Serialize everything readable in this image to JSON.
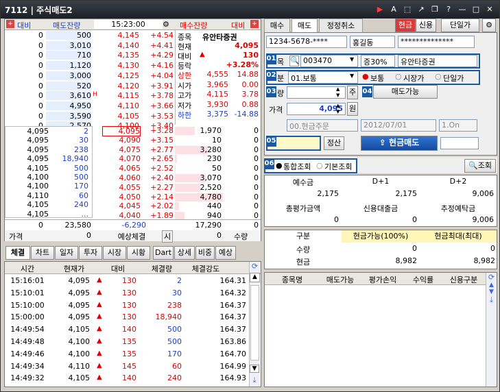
{
  "window": {
    "title": "7112 | 주식매도2"
  },
  "left": {
    "hdr": {
      "daebi": "대비",
      "sell_remain": "매도잔량",
      "time": "15:23:00",
      "buy_remain": "매수잔량",
      "daebi2": "대비"
    },
    "ask": [
      {
        "d": "0",
        "q": "500",
        "p": "4,145",
        "c": "+4.54"
      },
      {
        "d": "0",
        "q": "3,010",
        "p": "4,140",
        "c": "+4.41"
      },
      {
        "d": "0",
        "q": "710",
        "p": "4,135",
        "c": "+4.29"
      },
      {
        "d": "0",
        "q": "1,120",
        "p": "4,130",
        "c": "+4.16"
      },
      {
        "d": "0",
        "q": "3,000",
        "p": "4,125",
        "c": "+4.04"
      },
      {
        "d": "0",
        "q": "520",
        "p": "4,120",
        "c": "+3.91"
      },
      {
        "d": "0",
        "q": "3,610",
        "p": "4,115",
        "c": "+3.78",
        "mark": "H"
      },
      {
        "d": "0",
        "q": "4,950",
        "p": "4,110",
        "c": "+3.66"
      },
      {
        "d": "0",
        "q": "3,590",
        "p": "4,105",
        "c": "+3.53"
      },
      {
        "d": "0",
        "q": "2,570",
        "p": "4,100",
        "c": "+3.40"
      }
    ],
    "bid": [
      {
        "p": "4,095",
        "c": "+3.28",
        "q": "1,970",
        "d": "0"
      },
      {
        "p": "4,090",
        "c": "+3.15",
        "q": "10",
        "d": "0"
      },
      {
        "p": "4,075",
        "c": "+2.77",
        "q": "3,280",
        "d": "0"
      },
      {
        "p": "4,070",
        "c": "+2.65",
        "q": "230",
        "d": "0"
      },
      {
        "p": "4,065",
        "c": "+2.52",
        "q": "50",
        "d": "0"
      },
      {
        "p": "4,060",
        "c": "+2.40",
        "q": "3,070",
        "d": "0"
      },
      {
        "p": "4,055",
        "c": "+2.27",
        "q": "2,520",
        "d": "0"
      },
      {
        "p": "4,050",
        "c": "+2.14",
        "q": "4,780",
        "d": "0"
      },
      {
        "p": "4,045",
        "c": "+2.02",
        "q": "440",
        "d": "0"
      },
      {
        "p": "4,040",
        "c": "+1.89",
        "q": "940",
        "d": "0"
      }
    ],
    "trades": [
      {
        "p": "4,095",
        "q": "2"
      },
      {
        "p": "4,095",
        "q": "30"
      },
      {
        "p": "4,095",
        "q": "238"
      },
      {
        "p": "4,095",
        "q": "18,940"
      },
      {
        "p": "4,105",
        "q": "500"
      },
      {
        "p": "4,100",
        "q": "500"
      },
      {
        "p": "4,100",
        "q": "170"
      },
      {
        "p": "4,110",
        "q": "60"
      },
      {
        "p": "4,105",
        "q": "240"
      },
      {
        "p": "4,105",
        "q": "..."
      }
    ],
    "info": {
      "stock_lbl": "종목",
      "stock": "유안타증권",
      "cur_lbl": "현재",
      "cur": "4,095",
      "diff_lbl": "대비",
      "diff": "130",
      "rate_lbl": "등락",
      "rate": "+3.28%",
      "rows": [
        {
          "l": "상한",
          "v": "4,555",
          "r": "14.88",
          "cls": "red"
        },
        {
          "l": "시가",
          "v": "3,965",
          "r": "0.00",
          "cls": ""
        },
        {
          "l": "고가",
          "v": "4,115",
          "r": "3.78",
          "cls": ""
        },
        {
          "l": "저가",
          "v": "3,930",
          "r": "0.88",
          "cls": ""
        },
        {
          "l": "하한",
          "v": "3,375",
          "r": "-14.88",
          "cls": "blue"
        }
      ]
    },
    "totals": {
      "ask_total": "23,580",
      "diff_total": "-6,290",
      "bid_total": "17,290"
    },
    "footer": {
      "price_lbl": "가격",
      "price": "0",
      "expected": "예상체결",
      "si": "시",
      "qty": "0",
      "qty_lbl": "수량"
    },
    "tabs": [
      "체결",
      "차트",
      "일자",
      "투자",
      "시장",
      "시황",
      "Dart",
      "상세",
      "비중",
      "예상"
    ],
    "tick_hdr": [
      "시간",
      "현재가",
      "대비",
      "체결량",
      "체결강도"
    ],
    "ticks": [
      {
        "t": "15:16:01",
        "p": "4,095",
        "d": "130",
        "q": "2",
        "s": "164.31"
      },
      {
        "t": "15:10:01",
        "p": "4,095",
        "d": "130",
        "q": "30",
        "s": "164.32"
      },
      {
        "t": "15:10:00",
        "p": "4,095",
        "d": "130",
        "q": "238",
        "s": "164.37"
      },
      {
        "t": "15:00:00",
        "p": "4,095",
        "d": "130",
        "q": "18,940",
        "s": "164.37"
      },
      {
        "t": "14:49:54",
        "p": "4,105",
        "d": "140",
        "q": "500",
        "s": "164.37"
      },
      {
        "t": "14:49:48",
        "p": "4,100",
        "d": "135",
        "q": "500",
        "s": "163.86"
      },
      {
        "t": "14:49:46",
        "p": "4,100",
        "d": "135",
        "q": "170",
        "s": "164.70"
      },
      {
        "t": "14:49:34",
        "p": "4,110",
        "d": "145",
        "q": "60",
        "s": "164.99"
      },
      {
        "t": "14:49:32",
        "p": "4,105",
        "d": "140",
        "q": "240",
        "s": "164.93"
      }
    ]
  },
  "right": {
    "tabs": [
      "매수",
      "매도",
      "정정취소"
    ],
    "cash": "현금",
    "credit": "신용",
    "single": "단일가",
    "account": "1234-5678-****",
    "name": "홍길동",
    "password": "**************",
    "stock_lbl": "목",
    "code": "003470",
    "margin": "증30%",
    "stock_name": "유안타증권",
    "type_lbl": "분",
    "order_type": "01.보통",
    "radio": [
      "보통",
      "시장가",
      "단일가"
    ],
    "qty_lbl": "량",
    "qty_unit": "주",
    "sellable": "매도가능",
    "price_lbl": "가격",
    "price": "4,095",
    "price_unit": "원",
    "order_kind": "00.현금주문",
    "date": "2012/07/01",
    "days": "1.On",
    "pw_btn": "정산",
    "sell_btn": "현금매도",
    "view": [
      "통합조회",
      "기본조회"
    ],
    "query_btn": "조회",
    "deposit": {
      "h": [
        "예수금",
        "D+1",
        "D+2"
      ],
      "v": [
        "2,175",
        "2,175",
        "9,006"
      ]
    },
    "deposit2": {
      "h": [
        "총평가금액",
        "신용대출금",
        "추정예탁금"
      ],
      "v": [
        "0",
        "0",
        "9,006"
      ]
    },
    "avail": {
      "h": [
        "구분",
        "현금가능(100%)",
        "현금최대(최대)"
      ],
      "rows": [
        {
          "l": "수량",
          "a": "0",
          "b": "0"
        },
        {
          "l": "현금",
          "a": "8,982",
          "b": "8,982"
        }
      ]
    },
    "hold_hdr": [
      "종목명",
      "매도가능",
      "평가손익",
      "수익률",
      "신용구분"
    ]
  },
  "numtags": [
    "01",
    "02",
    "03",
    "04",
    "05",
    "06"
  ]
}
